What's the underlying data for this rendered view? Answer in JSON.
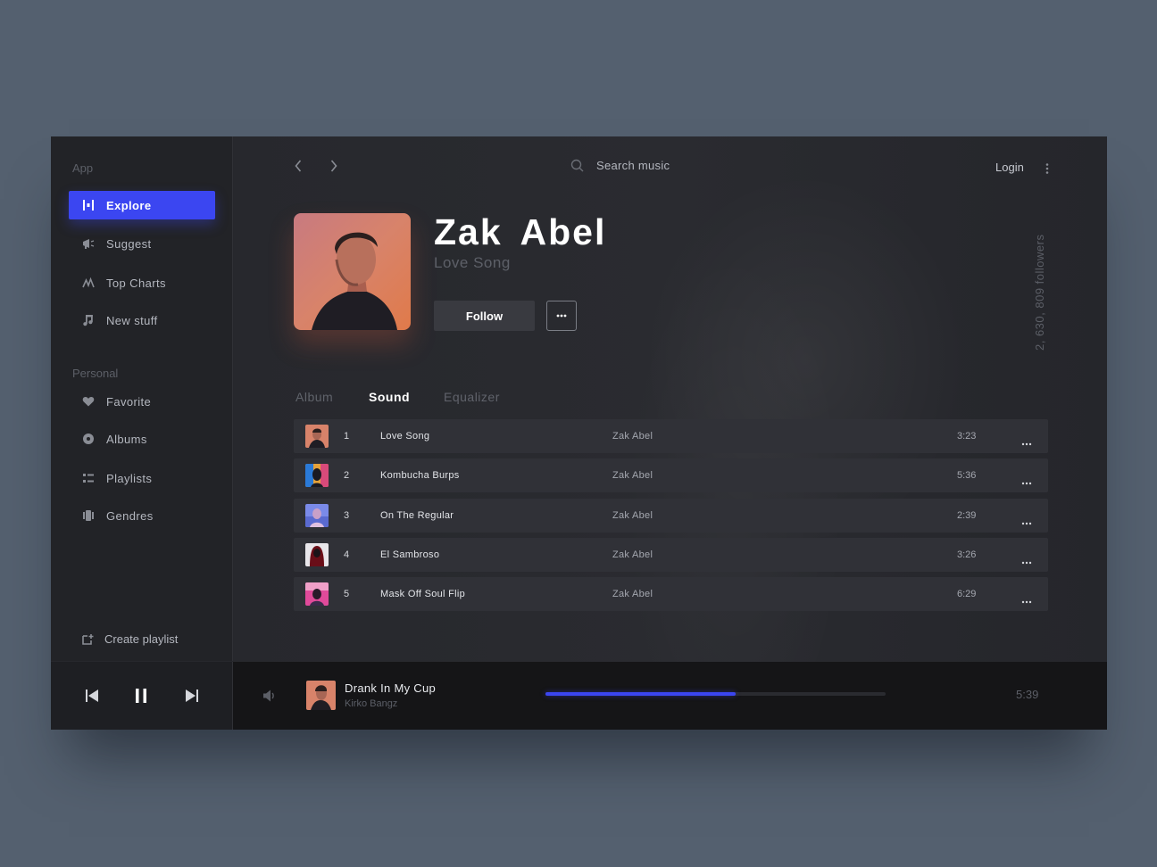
{
  "sidebar": {
    "app_label": "App",
    "app_items": [
      {
        "label": "Explore",
        "icon": "explore-icon"
      },
      {
        "label": "Suggest",
        "icon": "megaphone-icon"
      },
      {
        "label": "Top Charts",
        "icon": "chart-icon"
      },
      {
        "label": "New stuff",
        "icon": "music-note-icon"
      }
    ],
    "personal_label": "Personal",
    "personal_items": [
      {
        "label": "Favorite",
        "icon": "heart-icon"
      },
      {
        "label": "Albums",
        "icon": "disc-icon"
      },
      {
        "label": "Playlists",
        "icon": "list-icon"
      },
      {
        "label": "Gendres",
        "icon": "genres-icon"
      }
    ],
    "create_playlist": "Create playlist",
    "active_item": "Explore"
  },
  "topbar": {
    "search_placeholder": "Search music",
    "login": "Login"
  },
  "artist": {
    "name": "Zak Abel",
    "song": "Love Song",
    "follow_label": "Follow",
    "followers": "2, 630, 809 followers"
  },
  "tabs": [
    {
      "label": "Album",
      "active": false
    },
    {
      "label": "Sound",
      "active": true
    },
    {
      "label": "Equalizer",
      "active": false
    }
  ],
  "tracks": [
    {
      "num": "1",
      "title": "Love Song",
      "artist": "Zak Abel",
      "duration": "3:23"
    },
    {
      "num": "2",
      "title": "Kombucha Burps",
      "artist": "Zak Abel",
      "duration": "5:36"
    },
    {
      "num": "3",
      "title": "On The Regular",
      "artist": "Zak Abel",
      "duration": "2:39"
    },
    {
      "num": "4",
      "title": "El Sambroso",
      "artist": "Zak Abel",
      "duration": "3:26"
    },
    {
      "num": "5",
      "title": "Mask Off Soul Flip",
      "artist": "Zak Abel",
      "duration": "6:29"
    }
  ],
  "player": {
    "now_title": "Drank In My Cup",
    "now_artist": "Kirko Bangz",
    "time": "5:39",
    "progress": 0.56,
    "state": "playing"
  },
  "colors": {
    "accent": "#3b46f1",
    "background": "#26272c",
    "page": "#54606f"
  }
}
